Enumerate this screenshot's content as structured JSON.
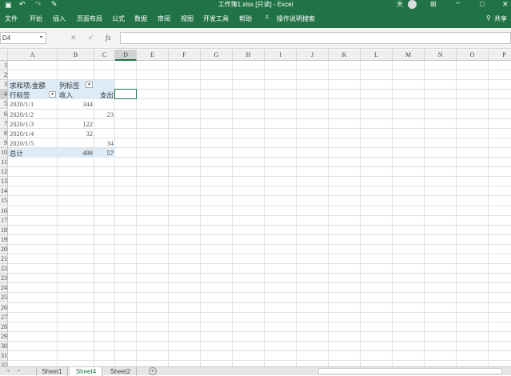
{
  "title": "工作簿1.xlsx [只读] - Excel",
  "user_label": "天",
  "ribbon_tabs": [
    "文件",
    "开始",
    "插入",
    "页面布局",
    "公式",
    "数据",
    "审阅",
    "视图",
    "开发工具",
    "帮助"
  ],
  "search_label": "操作说明搜索",
  "share_label": "共享",
  "name_box": "D4",
  "formula": "",
  "fx_label": "fx",
  "columns": [
    "A",
    "B",
    "C",
    "D",
    "E",
    "F",
    "G",
    "H",
    "I",
    "J",
    "K",
    "L",
    "M",
    "N",
    "O",
    "P"
  ],
  "row_count": 32,
  "pivot": {
    "header_label": "求和项:金额",
    "col_label": "列标签",
    "row_label": "行标签",
    "col_headers": [
      "收入",
      "支出"
    ],
    "rows": [
      {
        "label": "2020/1/1",
        "income": "344",
        "expense": ""
      },
      {
        "label": "2020/1/2",
        "income": "",
        "expense": "23"
      },
      {
        "label": "2020/1/3",
        "income": "122",
        "expense": ""
      },
      {
        "label": "2020/1/4",
        "income": "32",
        "expense": ""
      },
      {
        "label": "2020/1/5",
        "income": "",
        "expense": "34"
      }
    ],
    "total_label": "总计",
    "total_income": "498",
    "total_expense": "57"
  },
  "sheets": [
    {
      "name": "Sheet1",
      "active": false
    },
    {
      "name": "Sheet4",
      "active": true
    },
    {
      "name": "Sheet2",
      "active": false
    }
  ],
  "colors": {
    "accent": "#217346",
    "pivot_fill": "#ddebf7"
  }
}
